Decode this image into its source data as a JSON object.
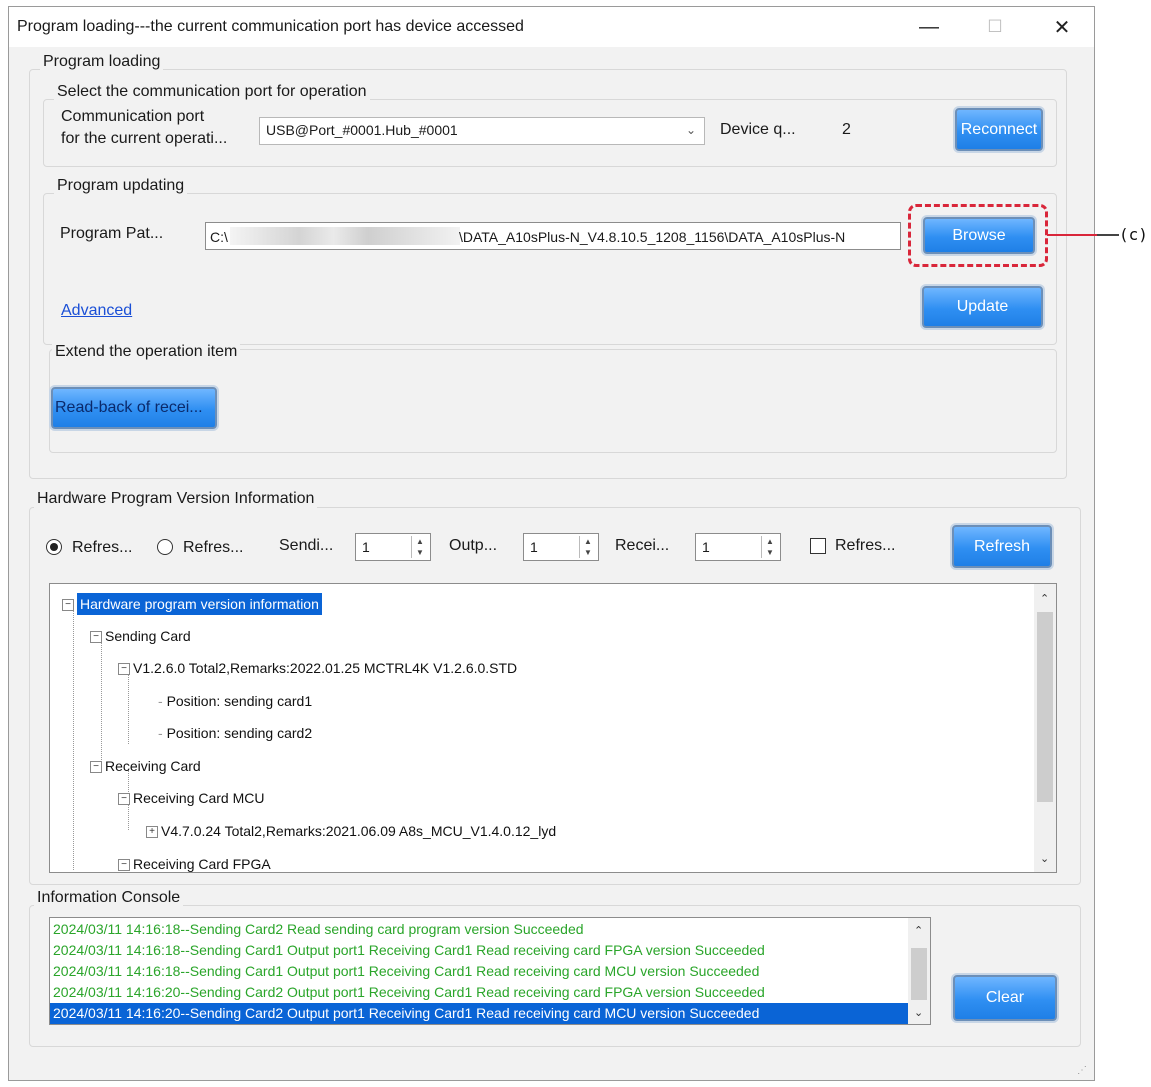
{
  "window": {
    "title": "Program loading---the current communication port has device accessed",
    "minimize": "—",
    "maximize": "☐",
    "close": "✕"
  },
  "program_loading": {
    "group_label": "Program loading",
    "port_group_label": "Select the communication port for operation",
    "port_label_line1": "Communication port",
    "port_label_line2": "for the current operati...",
    "port_value": "USB@Port_#0001.Hub_#0001",
    "device_qty_label": "Device q...",
    "device_qty_value": "2",
    "reconnect": "Reconnect",
    "updating_label": "Program updating",
    "path_label": "Program Pat...",
    "path_prefix": "C:\\",
    "path_suffix": "\\DATA_A10sPlus-N_V4.8.10.5_1208_1156\\DATA_A10sPlus-N",
    "browse": "Browse",
    "callout": "(c)",
    "advanced": "Advanced",
    "update": "Update",
    "extend_label": "Extend the operation item",
    "readback": "Read-back of recei..."
  },
  "hardware": {
    "group_label": "Hardware Program Version Information",
    "radio1": "Refres...",
    "radio2": "Refres...",
    "sending_label": "Sendi...",
    "sending_value": "1",
    "output_label": "Outp...",
    "output_value": "1",
    "receiving_label": "Recei...",
    "receiving_value": "1",
    "checkbox_label": "Refres...",
    "refresh": "Refresh",
    "tree": {
      "root": "Hardware program version information",
      "sending_card": "Sending Card",
      "sending_version": "V1.2.6.0 Total2,Remarks:2022.01.25 MCTRL4K V1.2.6.0.STD",
      "pos1": "Position: sending card1",
      "pos2": "Position: sending card2",
      "receiving_card": "Receiving Card",
      "receiving_mcu": "Receiving Card MCU",
      "mcu_version": "V4.7.0.24 Total2,Remarks:2021.06.09  A8s_MCU_V1.4.0.12_lyd",
      "receiving_fpga": "Receiving Card FPGA"
    }
  },
  "console": {
    "group_label": "Information Console",
    "lines": [
      "2024/03/11 14:16:18--Sending Card2 Read sending card program version Succeeded",
      "2024/03/11 14:16:18--Sending Card1 Output port1 Receiving Card1 Read receiving card FPGA version Succeeded",
      "2024/03/11 14:16:18--Sending Card1 Output port1 Receiving Card1 Read receiving card MCU version Succeeded",
      "2024/03/11 14:16:20--Sending Card2 Output port1 Receiving Card1 Read receiving card FPGA version Succeeded",
      "2024/03/11 14:16:20--Sending Card2 Output port1 Receiving Card1 Read receiving card MCU version Succeeded"
    ],
    "clear": "Clear"
  },
  "colors": {
    "accent_button": "#2f8ff2",
    "console_text": "#2aa52a",
    "selection": "#0a64d6",
    "callout": "#d9263a",
    "link": "#1a4fd6"
  },
  "icons": {
    "resize_grip": "resize-grip-icon",
    "dropdown": "chevron-down-icon"
  }
}
